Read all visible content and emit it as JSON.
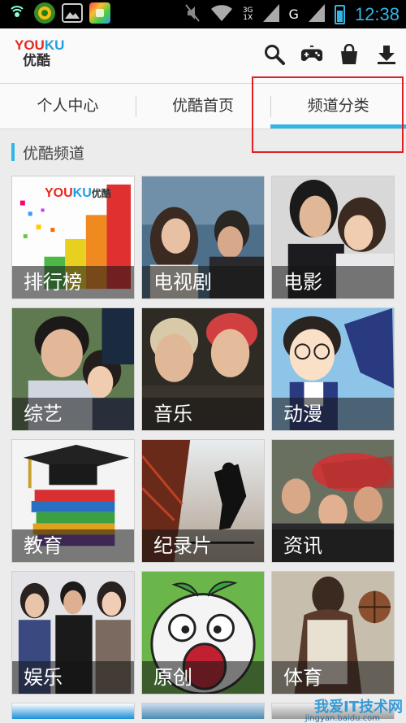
{
  "status_bar": {
    "network_small_top": "3G",
    "network_small_bottom": "1X",
    "network_g": "G",
    "time": "12:38"
  },
  "header": {
    "logo_en_you": "YOU",
    "logo_en_ku": "KU",
    "logo_cn": "优酷",
    "icons": [
      "search-icon",
      "gamepad-icon",
      "shopping-bag-icon",
      "download-icon"
    ]
  },
  "tabs": [
    {
      "label": "个人中心",
      "active": false
    },
    {
      "label": "优酷首页",
      "active": false
    },
    {
      "label": "频道分类",
      "active": true
    }
  ],
  "section": {
    "title": "优酷频道"
  },
  "channels": [
    {
      "label": "排行榜",
      "logo_you": "YOU",
      "logo_ku": "KU",
      "logo_cn": "优酷"
    },
    {
      "label": "电视剧"
    },
    {
      "label": "电影"
    },
    {
      "label": "综艺"
    },
    {
      "label": "音乐"
    },
    {
      "label": "动漫"
    },
    {
      "label": "教育"
    },
    {
      "label": "纪录片"
    },
    {
      "label": "资讯"
    },
    {
      "label": "娱乐"
    },
    {
      "label": "原创"
    },
    {
      "label": "体育"
    }
  ],
  "watermark": {
    "main": "我爱IT技术网",
    "sub": "jingyan.baidu.com"
  },
  "colors": {
    "accent": "#33b5e5",
    "highlight_box": "#e02020",
    "brand_red": "#e8281e",
    "brand_blue": "#1d9de2"
  }
}
